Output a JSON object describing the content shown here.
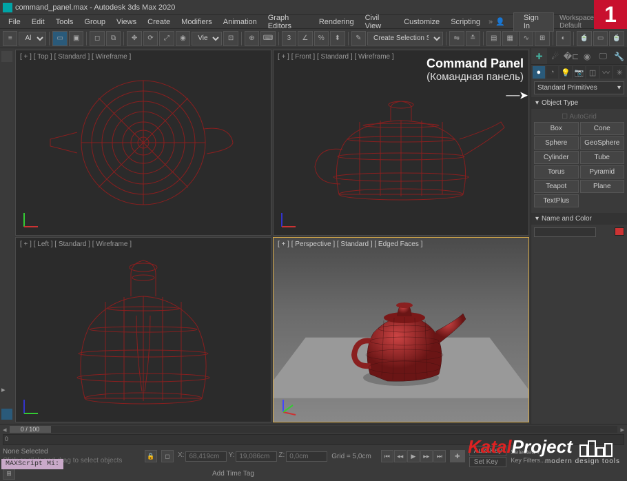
{
  "title": "command_panel.max - Autodesk 3ds Max 2020",
  "menu": [
    "File",
    "Edit",
    "Tools",
    "Group",
    "Views",
    "Create",
    "Modifiers",
    "Animation",
    "Graph Editors",
    "Rendering",
    "Civil View",
    "Customize",
    "Scripting"
  ],
  "signin_label": "Sign In",
  "workspace_label": "Workspaces: Default",
  "toolbar": {
    "all_filter": "All",
    "view_label": "View",
    "selection_set": "Create Selection Se"
  },
  "viewports": {
    "top": "[ + ] [ Top ] [ Standard ] [ Wireframe ]",
    "front": "[ + ] [ Front ] [ Standard ] [ Wireframe ]",
    "left": "[ + ] [ Left ] [ Standard ] [ Wireframe ]",
    "persp": "[ + ] [ Perspective ] [ Standard ] [ Edged Faces ]"
  },
  "annotation": {
    "en": "Command Panel",
    "ru": "(Командная панель)"
  },
  "command_panel": {
    "category": "Standard Primitives",
    "rollout_object_type": "Object Type",
    "autogrid": "AutoGrid",
    "primitives": [
      "Box",
      "Cone",
      "Sphere",
      "GeoSphere",
      "Cylinder",
      "Tube",
      "Torus",
      "Pyramid",
      "Teapot",
      "Plane",
      "TextPlus"
    ],
    "rollout_name_color": "Name and Color"
  },
  "timeline": {
    "frame": "0 / 100"
  },
  "status": {
    "selection": "None Selected",
    "hint": "Click or click-and-drag to select objects",
    "x_label": "X:",
    "x_val": "68,419cm",
    "y_label": "Y:",
    "y_val": "19,086cm",
    "z_label": "Z:",
    "z_val": "0,0cm",
    "grid": "Grid = 5,0cm",
    "add_time_tag": "Add Time Tag",
    "auto_key": "Auto Key",
    "set_key": "Set Key",
    "key_filters": "Key Filters..."
  },
  "maxscript": "MAXScript Mi:",
  "badge": "1",
  "watermark": {
    "brand_a": "Katal",
    "brand_b": "Project",
    "tag": "modern design tools"
  }
}
